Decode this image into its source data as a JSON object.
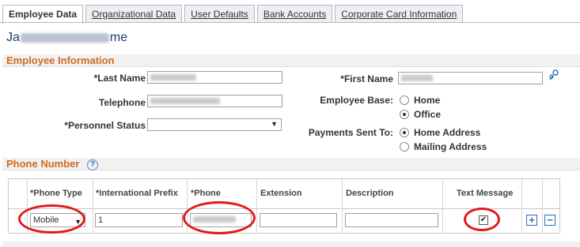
{
  "tabs": [
    "Employee Data",
    "Organizational Data",
    "User Defaults",
    "Bank Accounts",
    "Corporate Card Information"
  ],
  "employee": {
    "name_start": "Ja",
    "name_end": "me"
  },
  "employee_info": {
    "section_title": "Employee Information",
    "last_name_label": "*Last Name",
    "first_name_label": "*First Name",
    "telephone_label": "Telephone",
    "personnel_status_label": "*Personnel Status",
    "personnel_status_value": "",
    "employee_base_label": "Employee Base:",
    "employee_base_options": [
      "Home",
      "Office"
    ],
    "employee_base_selected": "Office",
    "payments_label": "Payments Sent To:",
    "payments_options": [
      "Home Address",
      "Mailing Address"
    ],
    "payments_selected": "Home Address"
  },
  "phone_number": {
    "section_title": "Phone Number",
    "help_symbol": "?",
    "columns": [
      "*Phone Type",
      "*International Prefix",
      "*Phone",
      "Extension",
      "Description",
      "Text Message"
    ],
    "rows": [
      {
        "phone_type": "Mobile",
        "international_prefix": "1",
        "extension": "",
        "description": "",
        "text_message": true
      }
    ],
    "add_symbol": "+",
    "remove_symbol": "−"
  },
  "colors": {
    "section_title": "#d2691e",
    "name": "#1a3e6f",
    "highlight_ring": "#e31919",
    "accent": "#2f6db5"
  },
  "icons": {
    "lookup": "people-lookup-icon",
    "checkmark": "✔"
  }
}
